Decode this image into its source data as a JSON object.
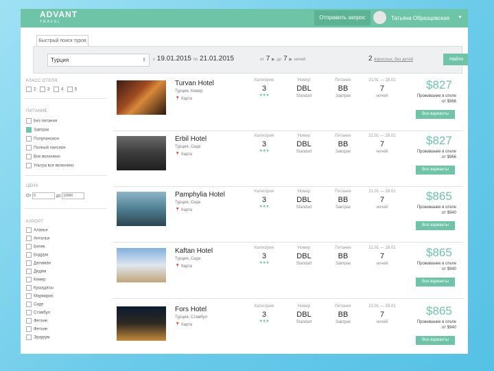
{
  "app": {
    "logo": "ADVANT",
    "logo_sub": "TRAVEL",
    "top_button": "Отправить запрос",
    "user_name": "Татьяна Образцовская"
  },
  "tab": {
    "label": "Быстрый поиск туров"
  },
  "search": {
    "destination": "Турция",
    "date_from_prefix": "с",
    "date_from": "19.01.2015",
    "date_to_prefix": "по",
    "date_to": "21.01.2015",
    "nights_from": "7",
    "nights_to": "7",
    "nights_prefix": "от",
    "nights_mid": "до",
    "nights_suffix": "ночей",
    "guests": "2",
    "guests_label": "взрослых, без детей",
    "find_button": "Найти"
  },
  "filters": {
    "class_heading": "КЛАСС ОТЕЛЯ",
    "classes": [
      "2",
      "3",
      "4",
      "5"
    ],
    "meal_heading": "ПИТАНИЕ",
    "meals": [
      {
        "label": "Без питания",
        "checked": false
      },
      {
        "label": "Завтрак",
        "checked": true
      },
      {
        "label": "Полупансион",
        "checked": false
      },
      {
        "label": "Полный пансион",
        "checked": false
      },
      {
        "label": "Все включено",
        "checked": false
      },
      {
        "label": "Ультра все включено",
        "checked": false
      }
    ],
    "price_heading": "ЦЕНА",
    "price_from_label": "От",
    "price_from": "0",
    "price_to_label": "до",
    "price_to": "10000",
    "resorts_heading": "КУРОРТ",
    "resorts": [
      "Аланья",
      "Анталья",
      "Белек",
      "Бодрум",
      "Даламан",
      "Дидим",
      "Кемер",
      "Кушадасы",
      "Мармарис",
      "Сиде",
      "Стамбул",
      "Фетхие",
      "Фетхие",
      "Эрзурум"
    ]
  },
  "columns": {
    "category": "Категория",
    "room": "Номер",
    "meal": "Питание",
    "nights": "ночей"
  },
  "hotels": [
    {
      "name": "Turvan Hotel",
      "location": "Турция, Кемер",
      "map": "Карта",
      "category": "3",
      "room": "DBL",
      "room_sub": "Standart",
      "meal": "BB",
      "meal_sub": "Завтрак",
      "date_label": "21.01 — 28.01",
      "nights": "7",
      "nights_sub": "ночей",
      "price": "$827",
      "price_text": "Проживание в отеле",
      "price_sub": "от $966",
      "button": "Все варианты"
    },
    {
      "name": "Erbil Hotel",
      "location": "Турция, Сиде",
      "map": "Карта",
      "category": "3",
      "room": "DBL",
      "room_sub": "Standart",
      "meal": "BB",
      "meal_sub": "Завтрак",
      "date_label": "21.01 — 28.01",
      "nights": "7",
      "nights_sub": "ночей",
      "price": "$827",
      "price_text": "Проживание в отеле",
      "price_sub": "от $966",
      "button": "Все варианты"
    },
    {
      "name": "Pamphylia Hotel",
      "location": "Турция, Сиде",
      "map": "Карта",
      "category": "3",
      "room": "DBL",
      "room_sub": "Standart",
      "meal": "BB",
      "meal_sub": "Завтрак",
      "date_label": "21.01 — 28.01",
      "nights": "7",
      "nights_sub": "ночей",
      "price": "$865",
      "price_text": "Проживание в отеле",
      "price_sub": "от $940",
      "button": "Все варианты"
    },
    {
      "name": "Kaftan Hotel",
      "location": "Турция, Сиде",
      "map": "Карта",
      "category": "3",
      "room": "DBL",
      "room_sub": "Standart",
      "meal": "BB",
      "meal_sub": "Завтрак",
      "date_label": "21.01 — 28.01",
      "nights": "7",
      "nights_sub": "ночей",
      "price": "$865",
      "price_text": "Проживание в отеле",
      "price_sub": "от $940",
      "button": "Все варианты"
    },
    {
      "name": "Fors Hotel",
      "location": "Турция, Стамбул",
      "map": "Карта",
      "category": "3",
      "room": "DBL",
      "room_sub": "Standart",
      "meal": "BB",
      "meal_sub": "Завтрак",
      "date_label": "21.01 — 28.01",
      "nights": "7",
      "nights_sub": "ночей",
      "price": "$865",
      "price_text": "Проживание в отеле",
      "price_sub": "от $940",
      "button": "Все варианты"
    }
  ],
  "colors": {
    "accent": "#6ec4a7",
    "background": "#7fd4ee"
  }
}
